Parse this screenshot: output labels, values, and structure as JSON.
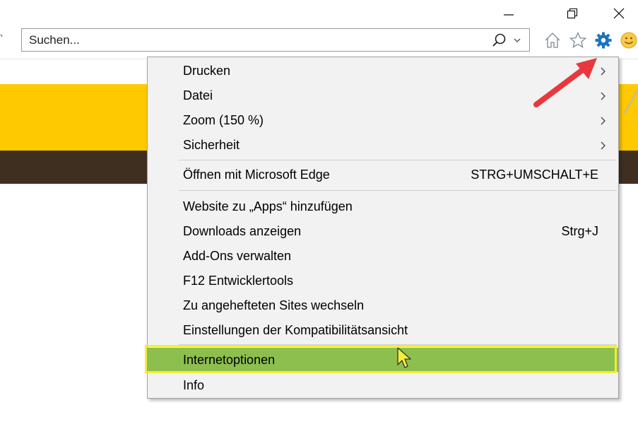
{
  "window": {
    "controls": {
      "minimize": "minimize-icon",
      "restore": "restore-icon",
      "close": "close-icon"
    }
  },
  "search": {
    "placeholder": "Suchen...",
    "left_edge_glyph": "‵"
  },
  "toolbar_icons": [
    "home-icon",
    "favorites-star-icon",
    "tools-gear-icon",
    "feedback-smiley-icon"
  ],
  "colors": {
    "yellow_band": "#ffc900",
    "brown_band": "#3f2f21",
    "menu_bg": "#f2f2f2",
    "highlight_green": "#8cbf4e",
    "highlight_frame": "#f3ec37",
    "arrow_red": "#e8383d",
    "gear_blue": "#1e73be"
  },
  "menu": {
    "items": [
      {
        "label": "Drucken",
        "submenu": true
      },
      {
        "label": "Datei",
        "submenu": true
      },
      {
        "label": "Zoom (150 %)",
        "submenu": true
      },
      {
        "label": "Sicherheit",
        "submenu": true
      },
      {
        "label": "Öffnen mit Microsoft Edge",
        "shortcut": "STRG+UMSCHALT+E"
      },
      {
        "label": "Website zu „Apps“ hinzufügen"
      },
      {
        "label": "Downloads anzeigen",
        "shortcut": "Strg+J"
      },
      {
        "label": "Add-Ons verwalten"
      },
      {
        "label": "F12 Entwicklertools"
      },
      {
        "label": "Zu angehefteten Sites wechseln"
      },
      {
        "label": "Einstellungen der Kompatibilitätsansicht"
      },
      {
        "label": "Internetoptionen",
        "highlighted": true
      },
      {
        "label": "Info"
      }
    ]
  }
}
